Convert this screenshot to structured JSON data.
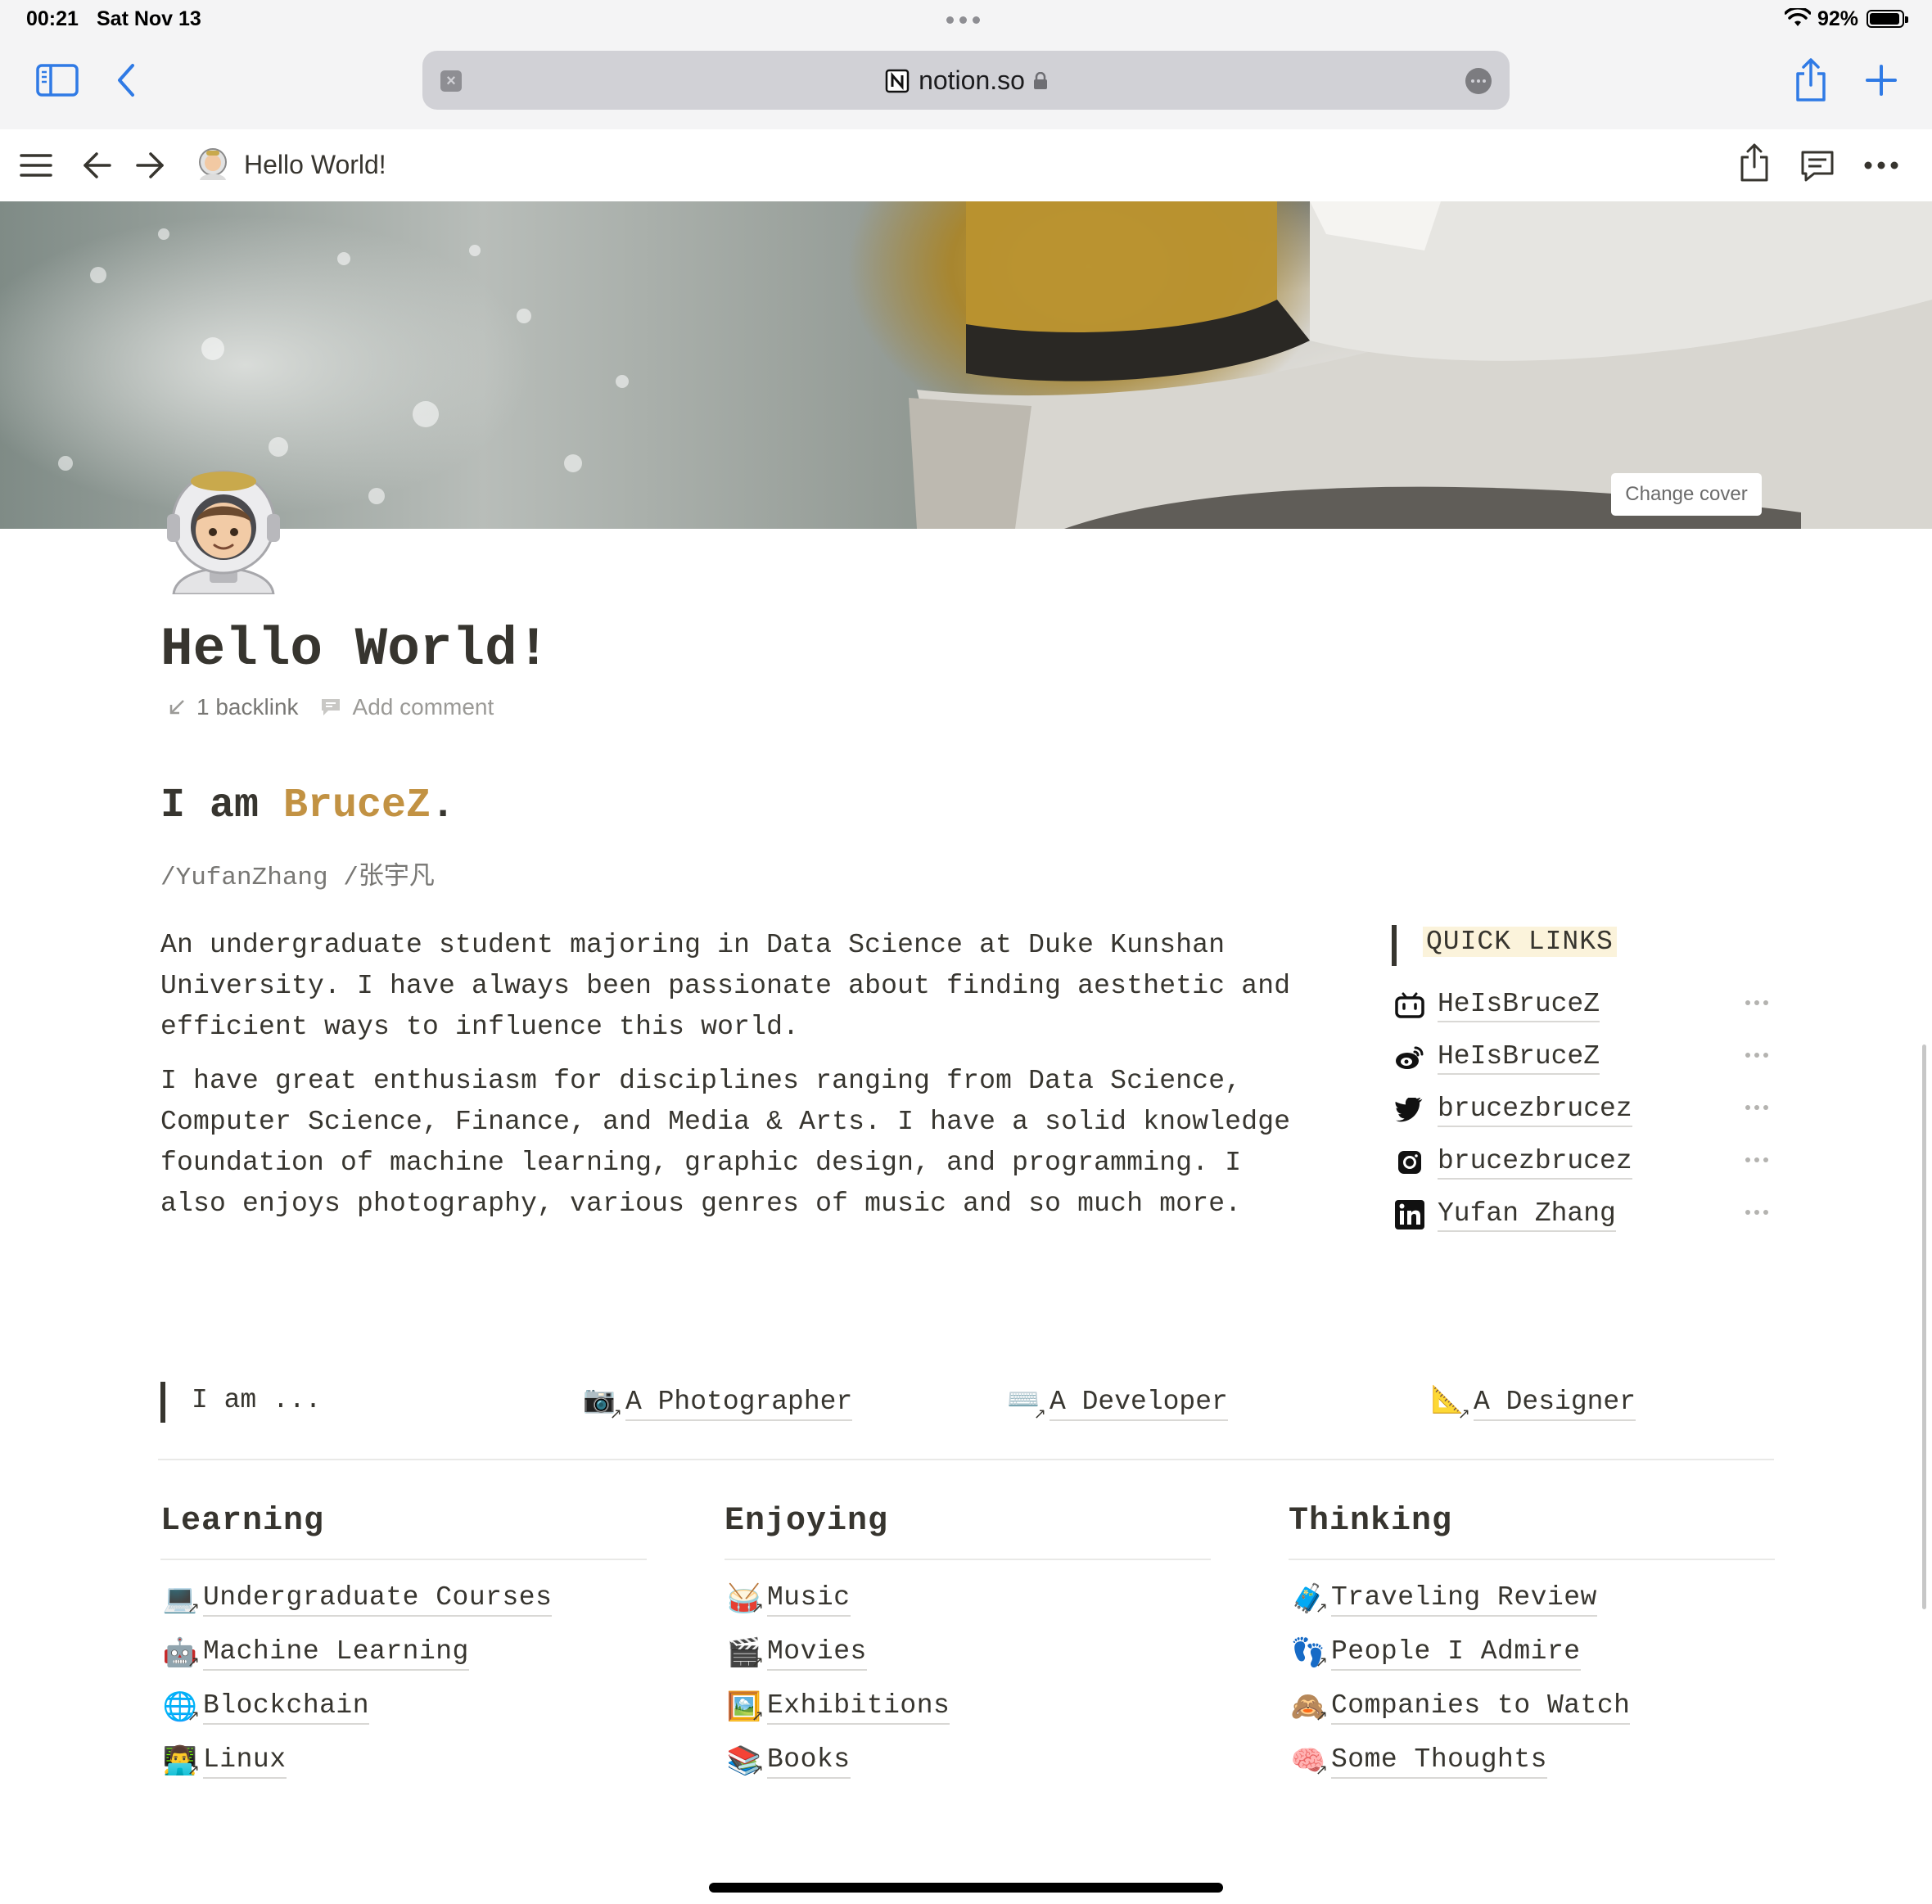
{
  "status_bar": {
    "time": "00:21",
    "date": "Sat Nov 13",
    "battery": "92%"
  },
  "safari": {
    "url": "notion.so"
  },
  "notion_bar": {
    "page_title": "Hello World!"
  },
  "cover": {
    "change_label": "Change cover"
  },
  "page": {
    "title": "Hello World!",
    "backlinks": "1 backlink",
    "add_comment": "Add comment",
    "heading_prefix": "I am ",
    "heading_name": "BruceZ",
    "heading_suffix": ".",
    "subname": "/YufanZhang /张宇凡",
    "paragraph1": "An undergraduate student majoring in Data Science at Duke Kunshan University. I have always been passionate about finding aesthetic and efficient ways to influence this world.",
    "paragraph2": "I have great enthusiasm for disciplines ranging from Data Science, Computer Science, Finance, and Media & Arts. I have a solid knowledge foundation of machine learning, graphic design, and programming. I also enjoys photography, various genres of music and so much more."
  },
  "quick_links": {
    "title": "QUICK LINKS",
    "items": [
      {
        "icon": "bilibili-icon",
        "label": "HeIsBruceZ"
      },
      {
        "icon": "weibo-icon",
        "label": "HeIsBruceZ"
      },
      {
        "icon": "twitter-icon",
        "label": "brucezbrucez"
      },
      {
        "icon": "instagram-icon",
        "label": "brucezbrucez"
      },
      {
        "icon": "linkedin-icon",
        "label": "Yufan Zhang"
      }
    ]
  },
  "i_am": {
    "label": "I am ...",
    "roles": [
      {
        "emoji": "📷",
        "label": "A Photographer"
      },
      {
        "emoji": "⌨️",
        "label": "A Developer"
      },
      {
        "emoji": "📐",
        "label": "A Designer"
      }
    ]
  },
  "columns": [
    {
      "heading": "Learning",
      "links": [
        {
          "emoji": "💻",
          "label": "Undergraduate Courses"
        },
        {
          "emoji": "🤖",
          "label": "Machine Learning"
        },
        {
          "emoji": "🌐",
          "label": "Blockchain"
        },
        {
          "emoji": "👨‍💻",
          "label": "Linux"
        }
      ]
    },
    {
      "heading": "Enjoying",
      "links": [
        {
          "emoji": "🥁",
          "label": "Music"
        },
        {
          "emoji": "🎬",
          "label": "Movies"
        },
        {
          "emoji": "🖼️",
          "label": "Exhibitions"
        },
        {
          "emoji": "📚",
          "label": "Books"
        }
      ]
    },
    {
      "heading": "Thinking",
      "links": [
        {
          "emoji": "🧳",
          "label": "Traveling Review"
        },
        {
          "emoji": "👣",
          "label": "People I Admire"
        },
        {
          "emoji": "🙈",
          "label": "Companies to Watch"
        },
        {
          "emoji": "🧠",
          "label": "Some Thoughts"
        }
      ]
    }
  ],
  "colors": {
    "accent": "#c29243",
    "text": "#37352f",
    "muted": "#9b9a97",
    "ios_blue": "#2f7ae5",
    "highlight": "#fbf3db"
  }
}
